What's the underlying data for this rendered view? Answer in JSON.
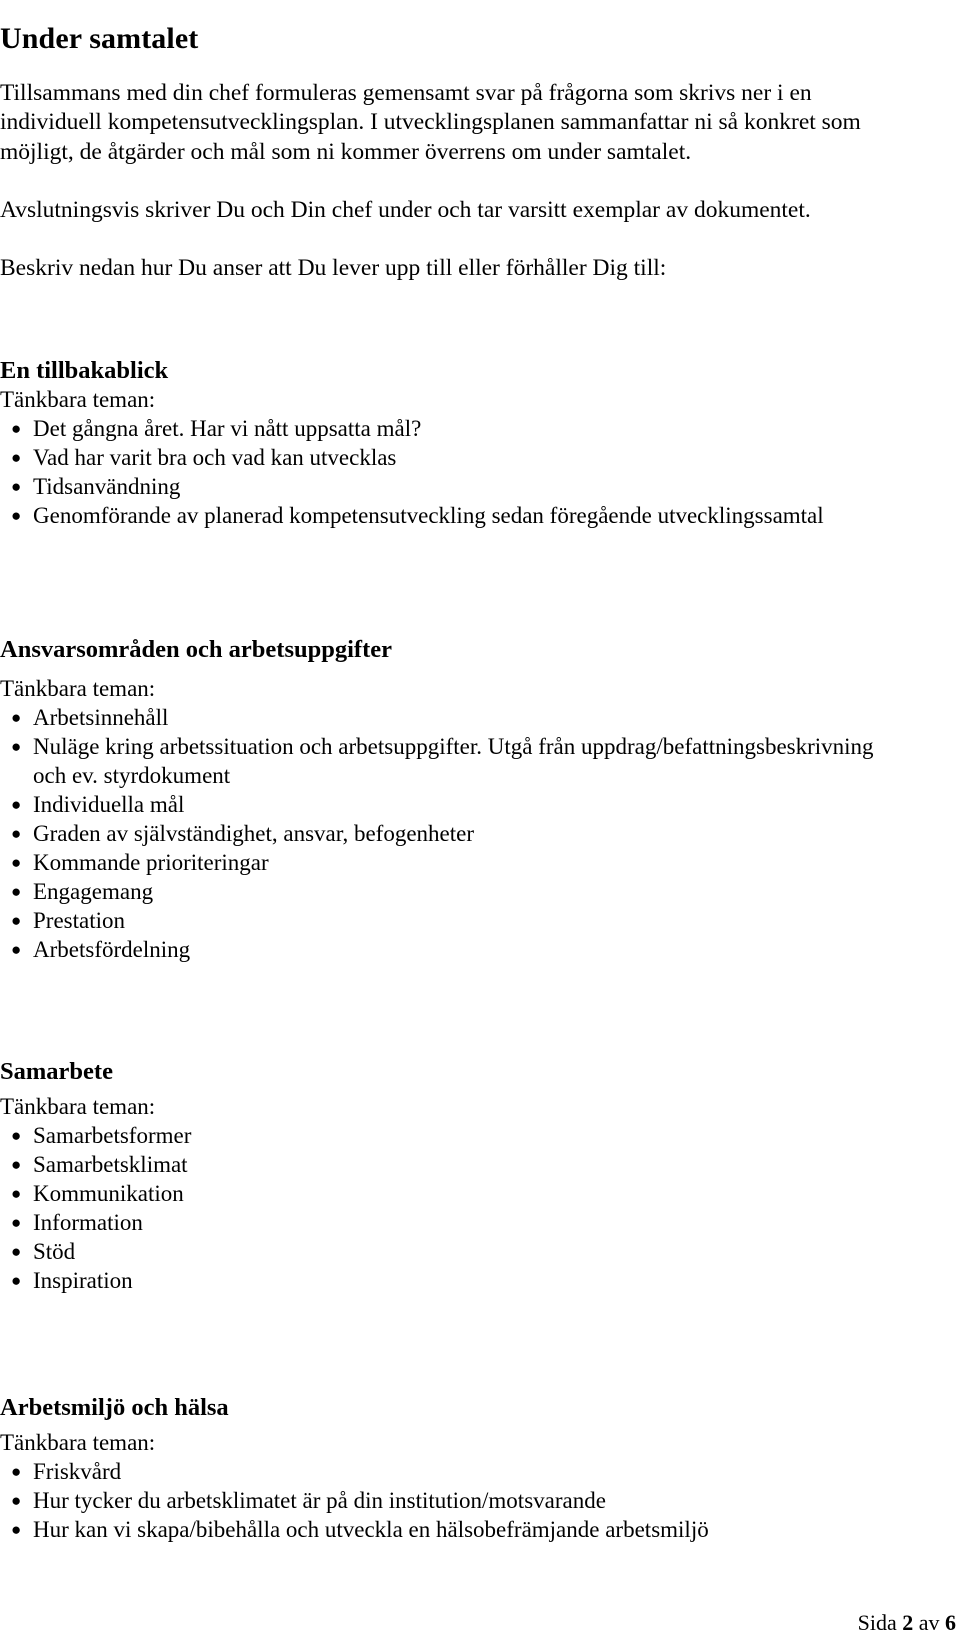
{
  "document": {
    "title": "Under samtalet",
    "language": "sv"
  },
  "intro": {
    "paragraph_1": "Tillsammans med din chef formuleras gemensamt svar på frågorna som skrivs ner i en individuell kompetensutvecklingsplan. I utvecklingsplanen sammanfattar ni så konkret som möjligt, de åtgärder och mål som ni kommer överrens om under samtalet.",
    "paragraph_2": "Avslutningsvis skriver Du och Din chef under och tar varsitt exemplar av dokumentet.",
    "paragraph_3": "Beskriv nedan hur Du anser att Du lever upp till eller förhåller Dig till:"
  },
  "teman_label": "Tänkbara teman:",
  "bullet_glyph": "●",
  "sections": [
    {
      "heading": "En tillbakablick",
      "teman_label": "Tänkbara teman:",
      "items": [
        "Det gångna året. Har vi nått uppsatta mål?",
        "Vad har varit bra och vad kan utvecklas",
        "Tidsanvändning",
        "Genomförande av planerad kompetensutveckling sedan föregående utvecklingssamtal"
      ]
    },
    {
      "heading": "Ansvarsområden och arbetsuppgifter",
      "teman_label": "Tänkbara teman:",
      "items": [
        "Arbetsinnehåll",
        "Nuläge kring arbetssituation och arbetsuppgifter. Utgå från uppdrag/befattningsbeskrivning och ev. styrdokument",
        "Individuella mål",
        "Graden av självständighet, ansvar, befogenheter",
        "Kommande prioriteringar",
        "Engagemang",
        "Prestation",
        "Arbetsfördelning"
      ]
    },
    {
      "heading": "Samarbete",
      "teman_label": "Tänkbara teman:",
      "items": [
        "Samarbetsformer",
        "Samarbetsklimat",
        "Kommunikation",
        "Information",
        "Stöd",
        "Inspiration"
      ]
    },
    {
      "heading": "Arbetsmiljö och hälsa",
      "teman_label": "Tänkbara teman:",
      "items": [
        "Friskvård",
        "Hur tycker du arbetsklimatet är på din institution/motsvarande",
        "Hur kan vi skapa/bibehålla och utveckla en hälsobefrämjande arbetsmiljö"
      ]
    }
  ],
  "footer": {
    "prefix": "Sida",
    "current_page": "2",
    "separator": "av",
    "total_pages": "6"
  },
  "colors": {
    "page_background": "#ffffff",
    "text": "#000000"
  }
}
